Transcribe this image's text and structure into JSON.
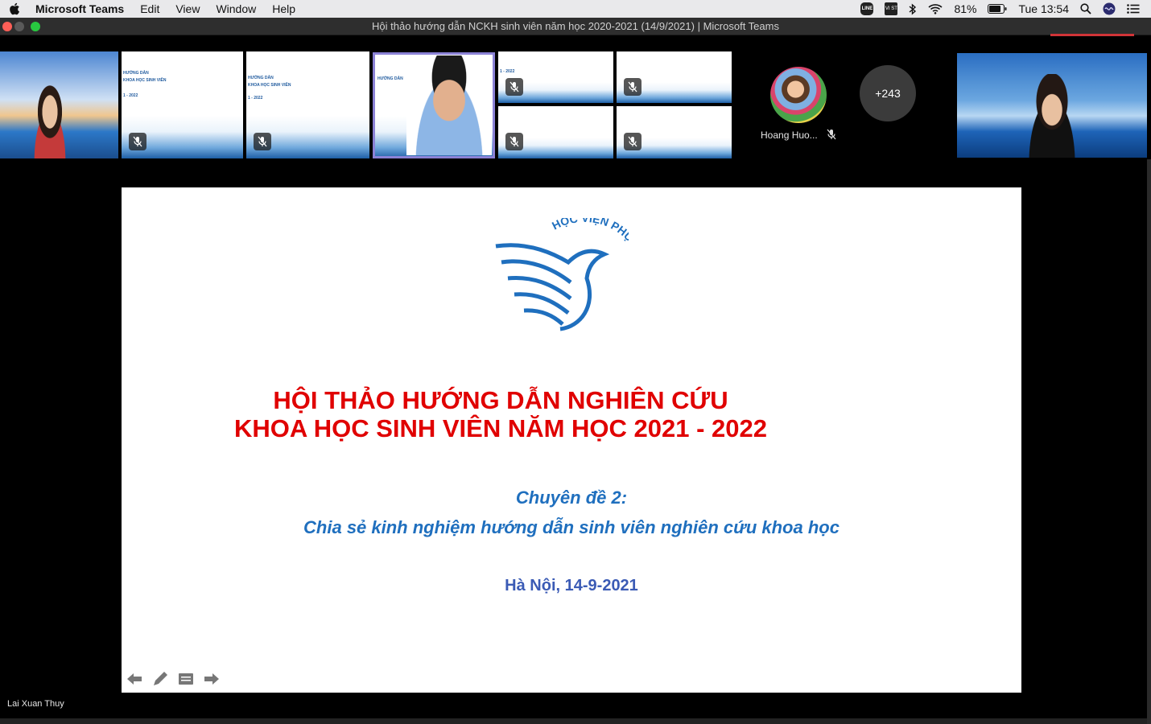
{
  "menubar": {
    "app_name": "Microsoft Teams",
    "items": [
      "Edit",
      "View",
      "Window",
      "Help"
    ],
    "line_label": "LINE",
    "vi_label": "VI ST",
    "battery": "81%",
    "clock": "Tue 13:54"
  },
  "window": {
    "title": "Hội thảo hướng dẫn NCKH sinh viên năm học 2020-2021 (14/9/2021) | Microsoft Teams"
  },
  "participants": {
    "avatar_name": "Hoang Huo...",
    "more_count": "+243",
    "thumb_heading": "HƯỚNG DẪN",
    "thumb_line": "KHOA HỌC SINH VIÊN",
    "thumb_year": "1 - 2022"
  },
  "slide": {
    "title_line1": "HỘI THẢO HƯỚNG DẪN NGHIÊN CỨU",
    "title_line2": "KHOA HỌC SINH VIÊN NĂM HỌC 2021 - 2022",
    "topic_label": "Chuyên đề 2:",
    "topic_title": "Chia sẻ kinh nghiệm hướng dẫn sinh viên nghiên cứu khoa học",
    "place_date": "Hà Nội, 14-9-2021",
    "logo_text": "HỌC VIỆN PHỤ NỮ VIỆT NAM"
  },
  "presenter": {
    "name": "Lai Xuan Thuy"
  },
  "colors": {
    "title_red": "#e00000",
    "subtitle_blue": "#1f6fbe",
    "logo_blue": "#1f6fbe",
    "selected_outline": "#8b82d6"
  }
}
